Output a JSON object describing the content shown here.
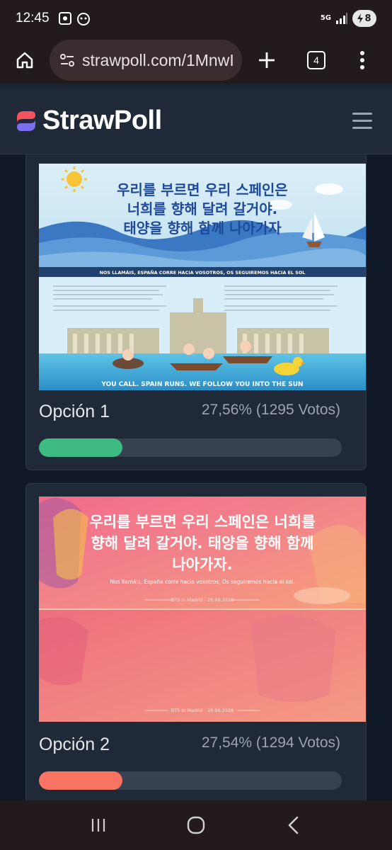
{
  "status_bar": {
    "time": "12:45",
    "network": "5G",
    "battery": "8"
  },
  "browser": {
    "url": "strawpoll.com/1MnwI",
    "tab_count": "4"
  },
  "site": {
    "brand": "StrawPoll"
  },
  "options": [
    {
      "label": "Opción 1",
      "result": "27,56% (1295 Votos)",
      "percent": 27.56,
      "bar_color": "#3dbb82",
      "image": {
        "korean_line1": "우리를 부르면 우리 스페인은",
        "korean_line2": "너희를 향해 달려 갈거야.",
        "korean_line3": "태양을 향해 함께 나아가자",
        "spanish_line": "NOS LLAMÁIS, ESPAÑA CORRE HACIA VOSOTROS, OS SEGUIREMOS HACIA EL SOL",
        "english_line": "YOU CALL. SPAIN RUNS. WE FOLLOW YOU INTO THE SUN"
      }
    },
    {
      "label": "Opción 2",
      "result": "27,54% (1294 Votos)",
      "percent": 27.54,
      "bar_color": "#f87362",
      "image": {
        "korean_line1": "우리를 부르면 우리 스페인은 너희를",
        "korean_line2": "향해 달려 갈거야. 태양을 향해 함께",
        "korean_line3": "나아가자.",
        "spanish_line": "Nos llamáis, España corre hacia vosotros, Os seguiremos hacia el sol.",
        "footer_top": "BTS in Madrid - 26.06.2026",
        "footer_bottom": "BTS in Madrid - 26.06.2026"
      }
    }
  ]
}
